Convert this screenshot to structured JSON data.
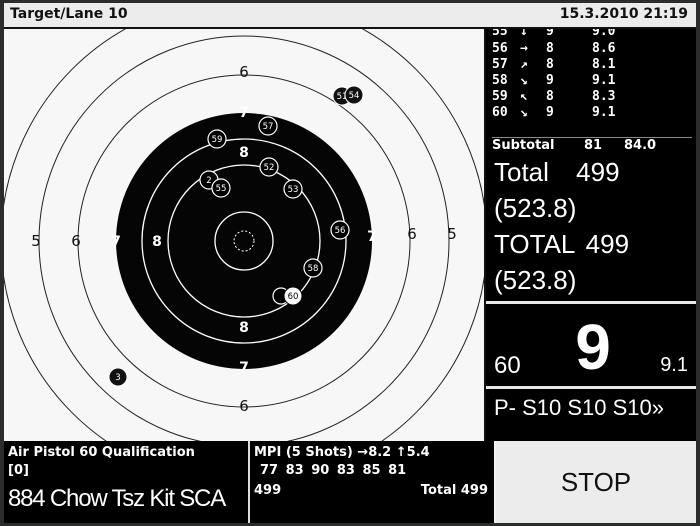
{
  "header": {
    "title": "Target/Lane 10",
    "datetime": "15.3.2010 21:19"
  },
  "target": {
    "ring_labels": {
      "r5": "5",
      "r6": "6",
      "r7": "7",
      "r8": "8"
    },
    "shots": [
      {
        "id": "51"
      },
      {
        "id": "54"
      },
      {
        "id": "59"
      },
      {
        "id": "57"
      },
      {
        "id": "52"
      },
      {
        "id": "2"
      },
      {
        "id": "55"
      },
      {
        "id": "53"
      },
      {
        "id": "56"
      },
      {
        "id": "58"
      },
      {
        "id": "60",
        "highlight": true
      },
      {
        "id": "3"
      }
    ]
  },
  "shot_list": [
    {
      "num": "55",
      "dir": "↓",
      "value": "9",
      "decimal": "9.0"
    },
    {
      "num": "56",
      "dir": "→",
      "value": "8",
      "decimal": "8.6"
    },
    {
      "num": "57",
      "dir": "↗",
      "value": "8",
      "decimal": "8.1"
    },
    {
      "num": "58",
      "dir": "↘",
      "value": "9",
      "decimal": "9.1"
    },
    {
      "num": "59",
      "dir": "↖",
      "value": "8",
      "decimal": "8.3"
    },
    {
      "num": "60",
      "dir": "↘",
      "value": "9",
      "decimal": "9.1"
    }
  ],
  "subtotal": {
    "label": "Subtotal",
    "value": "81",
    "decimal": "84.0"
  },
  "totals": {
    "total_label": "Total",
    "total_value": "499",
    "total_decimal": "(523.8)",
    "grand_label": "TOTAL",
    "grand_value": "499",
    "grand_decimal": "(523.8)"
  },
  "last_shot": {
    "number": "60",
    "ring": "9",
    "decimal": "9.1"
  },
  "series_line": "P- S10 S10 S10»",
  "event": {
    "name": "Air Pistol 60 Qualification",
    "relay": "[0]",
    "shooter": "884 Chow Tsz Kit SCA"
  },
  "mpi": {
    "label": "MPI (5 Shots) →8.2  ↑5.4",
    "series": "77 83 90 83 85 81",
    "score": "499",
    "total": "Total 499"
  },
  "stop_label": "STOP"
}
